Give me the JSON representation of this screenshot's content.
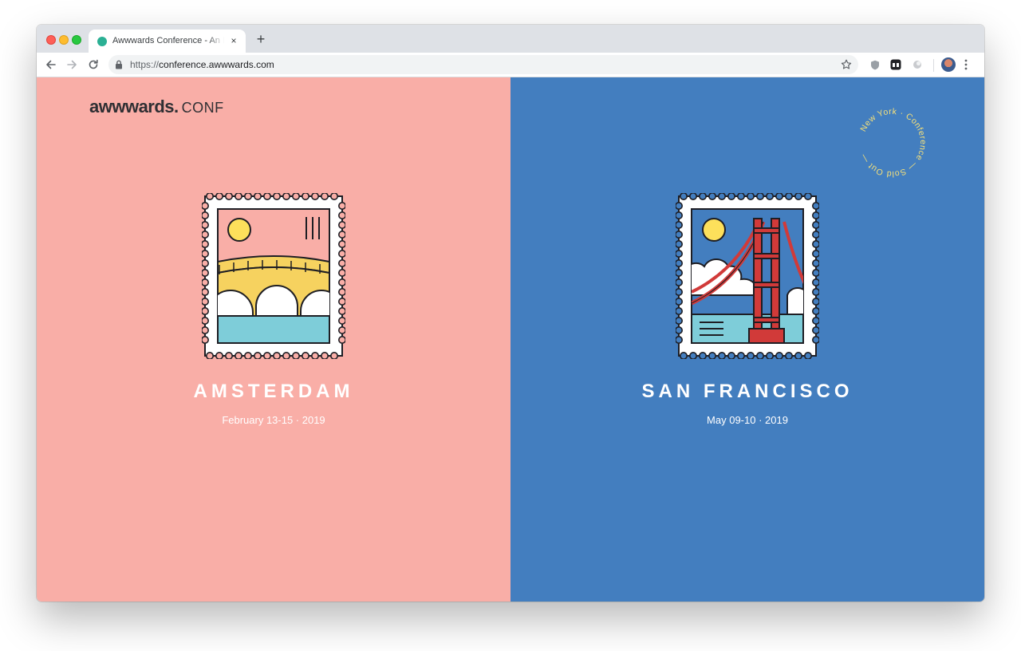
{
  "browser": {
    "tab_title": "Awwwards Conference - An Event for Web Designers",
    "tab_close_icon": "×",
    "new_tab_icon": "+",
    "url_scheme": "https://",
    "url_host": "conference.awwwards.com"
  },
  "header": {
    "logo_brand": "awwwards.",
    "logo_suffix": "CONF"
  },
  "events": [
    {
      "city": "AMSTERDAM",
      "date": "February 13-15 · 2019",
      "background": "#f9aea7",
      "stamp": "amsterdam-bridge-stamp"
    },
    {
      "city": "SAN FRANCISCO",
      "date": "May 09-10 · 2019",
      "background": "#437ebf",
      "stamp": "golden-gate-bridge-stamp"
    }
  ],
  "badge": {
    "text": "New York · Conference — Sold Out —",
    "color": "#f5e07a"
  },
  "colors": {
    "stamp_sun": "#fde05b",
    "stamp_water": "#7ecdd9",
    "bridge_yellow": "#f6d25f",
    "bridge_red": "#d13a39"
  }
}
